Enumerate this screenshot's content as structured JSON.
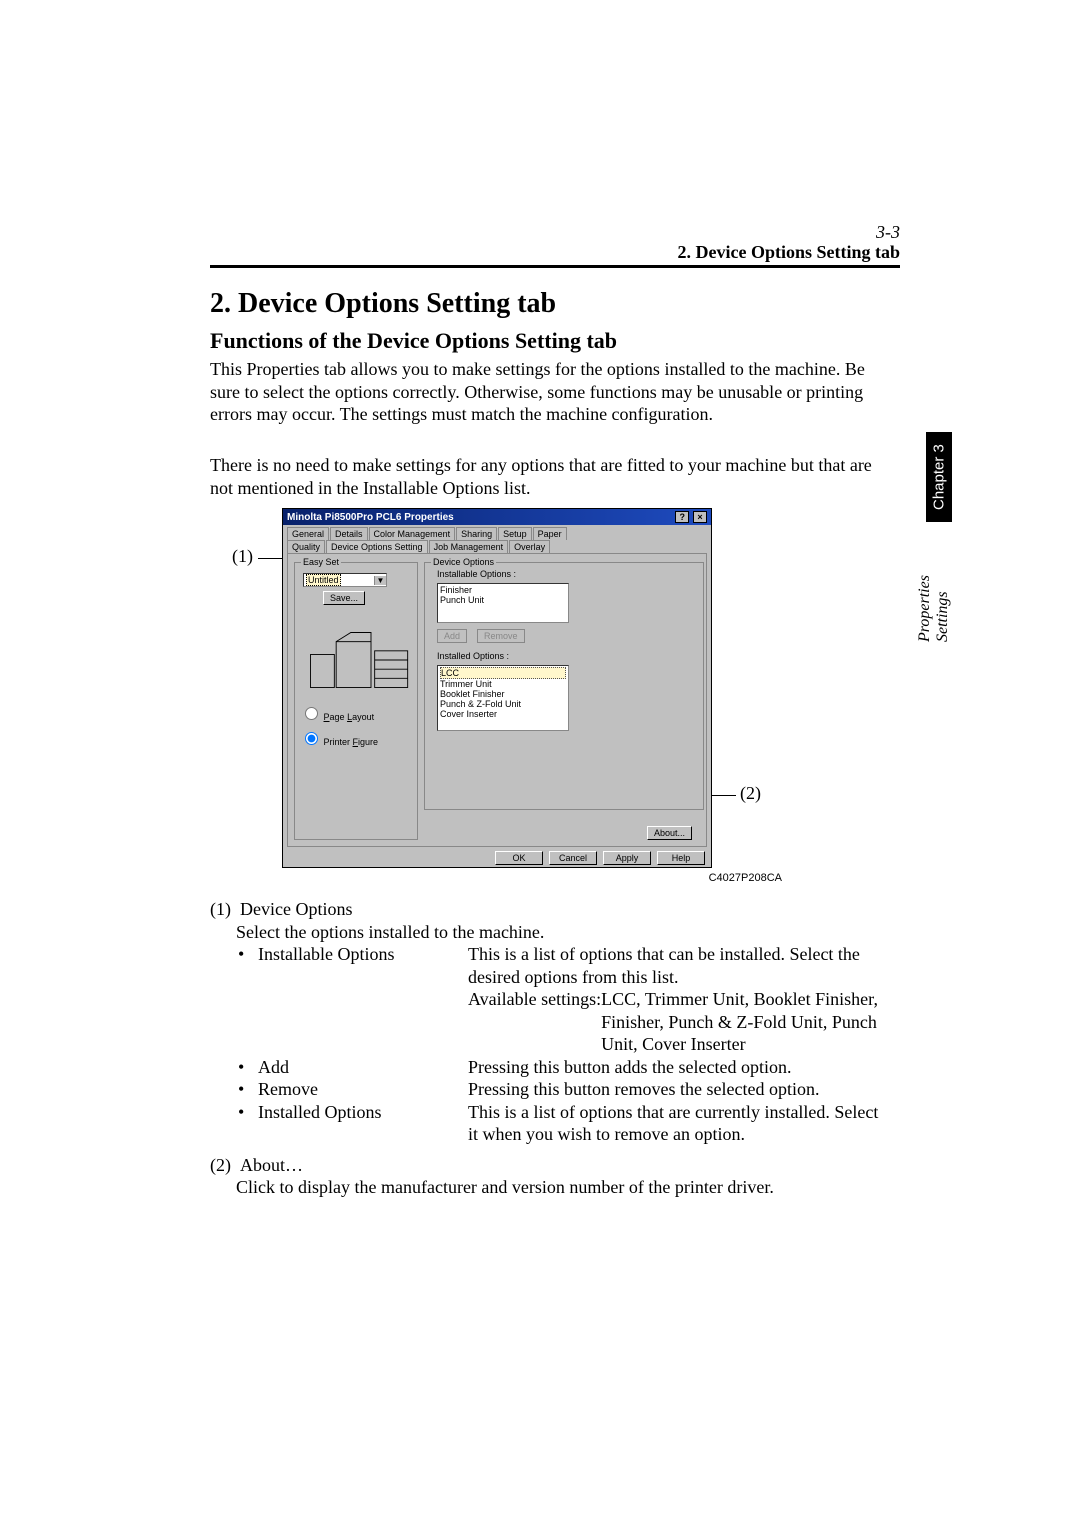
{
  "page": {
    "number": "3-3",
    "header_title": "2. Device Options Setting tab",
    "section_heading": "2.   Device Options Setting tab",
    "subheading": "Functions of the Device Options Setting tab",
    "para1": "This Properties tab allows you to make settings for the options installed to the machine. Be sure to select the options correctly. Otherwise, some functions may be unusable or printing errors may occur. The settings must match the machine configuration.",
    "para2": "There is no need to make settings for any options that are fitted to your machine but that are not mentioned in the Installable Options list."
  },
  "side": {
    "chapter": "Chapter 3",
    "section": "Properties Settings"
  },
  "callouts": {
    "c1": "(1)",
    "c2": "(2)"
  },
  "fig_code": "C4027P208CA",
  "dialog": {
    "title": "Minolta Pi8500Pro PCL6 Properties",
    "winbtns": {
      "help": "?",
      "close": "×"
    },
    "tabs_row1": [
      "General",
      "Details",
      "Color Management",
      "Sharing",
      "Setup",
      "Paper"
    ],
    "tabs_row2": [
      "Quality",
      "Device Options Setting",
      "Job Management",
      "Overlay"
    ],
    "easyset": {
      "group": "Easy Set",
      "combo_value": "Untitled",
      "save": "Save..."
    },
    "view": {
      "page_layout": "Page Layout",
      "printer_figure": "Printer Figure"
    },
    "device_options": {
      "group": "Device Options",
      "installable_label": "Installable Options :",
      "installable_items": [
        "Finisher",
        "Punch Unit"
      ],
      "add": "Add",
      "remove": "Remove",
      "installed_label": "Installed Options :",
      "installed_items": [
        "LCC",
        "Trimmer Unit",
        "Booklet Finisher",
        "Punch & Z-Fold Unit",
        "Cover Inserter"
      ]
    },
    "about": "About...",
    "buttons": {
      "ok": "OK",
      "cancel": "Cancel",
      "apply": "Apply",
      "help": "Help"
    }
  },
  "list": {
    "item1_num": "(1)",
    "item1_title": "Device Options",
    "item1_lead": "Select the options installed to the machine.",
    "installable_label": "Installable Options",
    "installable_desc1": "This is a list of options that can be installed. Select the desired options from this list.",
    "installable_avail_label": "Available settings:  ",
    "installable_avail": "LCC, Trimmer Unit, Booklet Finisher, Finisher, Punch & Z-Fold Unit, Punch Unit, Cover Inserter",
    "add_label": "Add",
    "add_desc": "Pressing this button adds the selected option.",
    "remove_label": "Remove",
    "remove_desc": "Pressing this button removes the selected option.",
    "installed_label": "Installed Options",
    "installed_desc": "This is a list of options that are currently installed. Select it when you wish to remove an option.",
    "item2_num": "(2)",
    "item2_title": "About…",
    "item2_desc": "Click to display the manufacturer and version number of the printer driver."
  }
}
